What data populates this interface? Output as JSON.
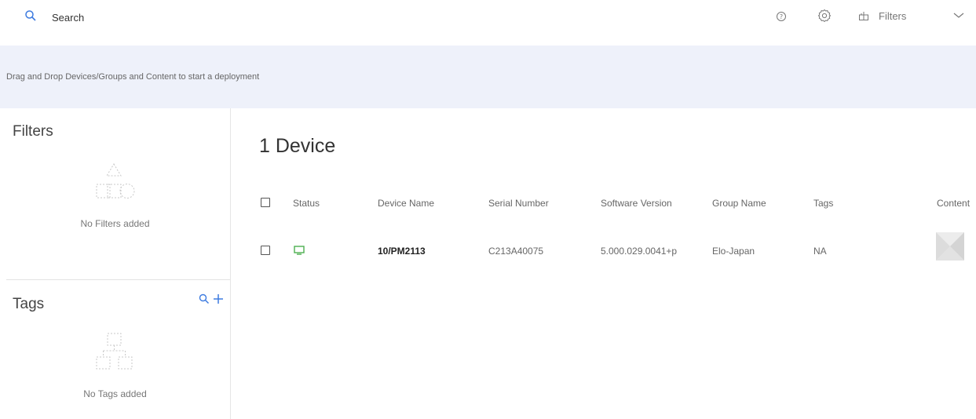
{
  "header": {
    "search_placeholder": "Search",
    "filters_label": "Filters"
  },
  "deploy_bar": {
    "message": "Drag and Drop Devices/Groups and Content to start a deployment"
  },
  "sidebar": {
    "filters_title": "Filters",
    "filters_empty": "No Filters added",
    "tags_title": "Tags",
    "tags_empty": "No Tags added"
  },
  "main": {
    "device_count": "1 Device",
    "columns": [
      "Status",
      "Device Name",
      "Serial Number",
      "Software Version",
      "Group Name",
      "Tags",
      "Content"
    ],
    "rows": [
      {
        "status": "online",
        "device_name": "10/PM2113",
        "serial_number": "C213A40075",
        "software_version": "5.000.029.0041+p",
        "group_name": "Elo-Japan",
        "tags": "NA"
      }
    ]
  },
  "colors": {
    "accent": "#3d7be0",
    "status_online": "#4caf50",
    "deploy_bar_bg": "#eef1fa"
  },
  "icons": [
    "search-icon",
    "help-icon",
    "gear-icon",
    "filter-icon",
    "chevron-down-icon",
    "shapes-icon",
    "hierarchy-icon",
    "monitor-icon",
    "plus-icon"
  ]
}
